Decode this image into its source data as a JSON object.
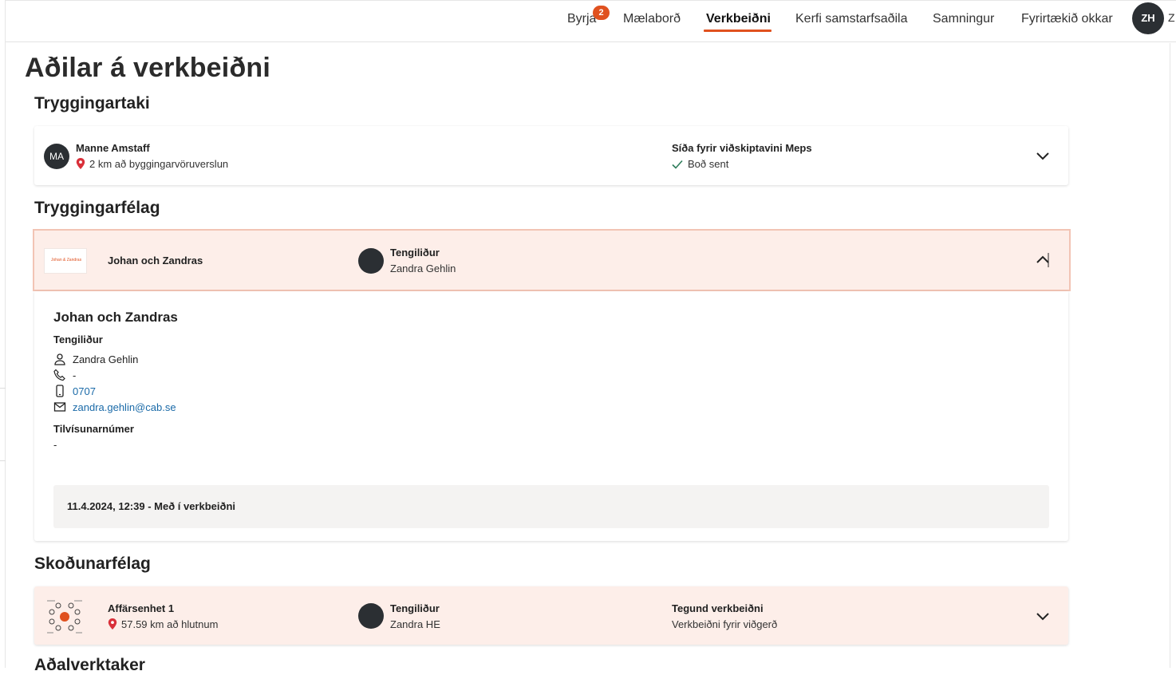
{
  "nav": {
    "items": [
      {
        "label": "Byrja",
        "badge": "2"
      },
      {
        "label": "Mælaborð"
      },
      {
        "label": "Verkbeiðni",
        "active": true
      },
      {
        "label": "Kerfi samstarfsaðila"
      },
      {
        "label": "Samningur"
      },
      {
        "label": "Fyrirtækið okkar"
      }
    ],
    "user_initials": "ZH",
    "user_name_fragment": "Z"
  },
  "page_title": "Aðilar á verkbeiðni",
  "policyholder": {
    "section_title": "Tryggingartaki",
    "initials": "MA",
    "name": "Manne Amstaff",
    "distance": "2 km að byggingarvöruverslun",
    "portal_label": "Síða fyrir viðskiptavini Meps",
    "portal_status": "Boð sent"
  },
  "insurer": {
    "section_title": "Tryggingarfélag",
    "logo_text": "Johan & Zandras",
    "name": "Johan och Zandras",
    "contact_label": "Tengiliður",
    "contact_name": "Zandra Gehlin",
    "details": {
      "title": "Johan och Zandras",
      "contact_label": "Tengiliður",
      "person": "Zandra Gehlin",
      "phone": "-",
      "mobile": "0707",
      "email": "zandra.gehlin@cab.se",
      "reference_label": "Tilvísunarnúmer",
      "reference_value": "-",
      "history": "11.4.2024, 12:39 - Með í verkbeiðni"
    }
  },
  "inspector": {
    "section_title": "Skoðunarfélag",
    "name": "Affärsenhet 1",
    "distance": "57.59 km að hlutnum",
    "contact_label": "Tengiliður",
    "contact_name": "Zandra HE",
    "type_label": "Tegund verkbeiðni",
    "type_value": "Verkbeiðni fyrir viðgerð"
  },
  "next_section_title": "Aðalverktaker",
  "colors": {
    "accent": "#e0511f",
    "highlight_bg": "#fdeee9",
    "link": "#1a6aa8",
    "pin": "#d9303a",
    "check": "#2e7d5b"
  }
}
